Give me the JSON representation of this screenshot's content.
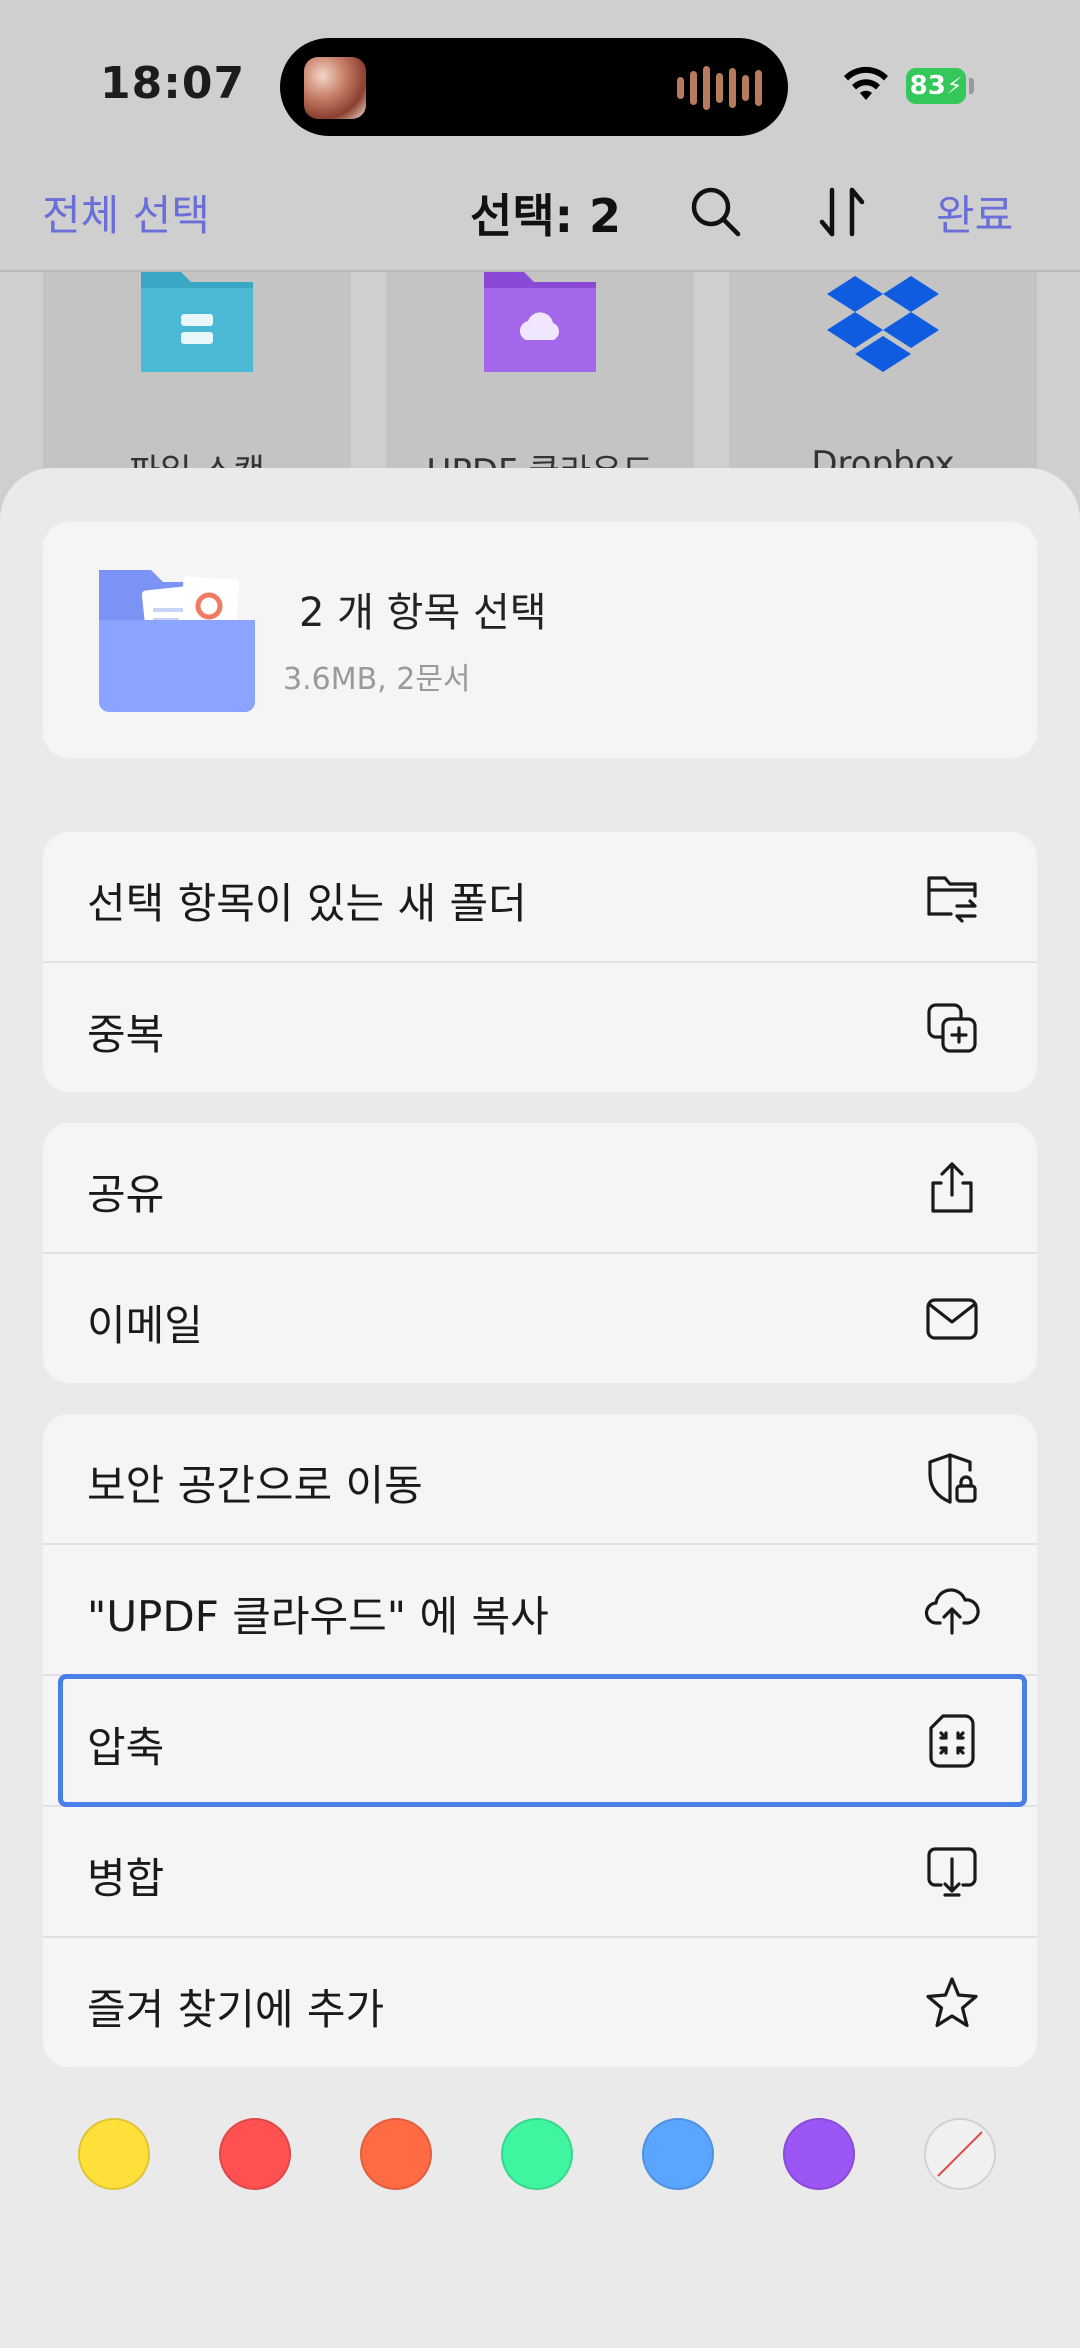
{
  "status_bar": {
    "time": "18:07",
    "battery": "83"
  },
  "nav": {
    "select_all": "전체 선택",
    "selection_count": "선택: 2",
    "done": "완료"
  },
  "background_folders": [
    {
      "label": "파일 스캔",
      "icon": "teal-folder-icon",
      "color": "#3aa7c4"
    },
    {
      "label": "UPDF 클라우드",
      "icon": "cloud-folder-icon",
      "color": "#9b5de5"
    },
    {
      "label": "Dropbox",
      "icon": "dropbox-icon",
      "color": "#0f5ce0"
    }
  ],
  "summary": {
    "title": "2 개 항목 선택",
    "subtitle": "3.6MB, 2문서"
  },
  "groups": [
    {
      "items": [
        {
          "label": "선택 항목이 있는 새 폴더",
          "icon": "new-folder-move-icon"
        },
        {
          "label": "중복",
          "icon": "duplicate-icon"
        }
      ]
    },
    {
      "items": [
        {
          "label": "공유",
          "icon": "share-icon"
        },
        {
          "label": "이메일",
          "icon": "mail-icon"
        }
      ]
    },
    {
      "items": [
        {
          "label": "보안 공간으로 이동",
          "icon": "shield-lock-icon"
        },
        {
          "label": "\"UPDF 클라우드\" 에 복사",
          "icon": "cloud-upload-icon"
        },
        {
          "label": "압축",
          "icon": "compress-icon",
          "highlighted": true
        },
        {
          "label": "병합",
          "icon": "merge-icon"
        },
        {
          "label": "즐겨 찾기에 추가",
          "icon": "star-icon"
        }
      ]
    }
  ],
  "color_tags": [
    "#ffe03b",
    "#ff5151",
    "#ff6b45",
    "#3ff5a0",
    "#5aa5ff",
    "#9b56f5",
    "none"
  ],
  "accent_color": "#6a6fd8",
  "highlight_color": "#4a7ee8"
}
